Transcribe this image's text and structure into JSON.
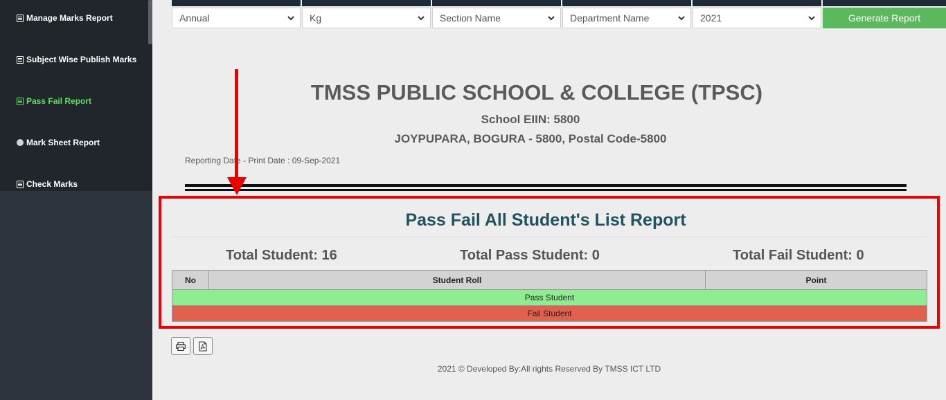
{
  "sidebar": {
    "items": [
      {
        "label": "Manage Marks Report",
        "icon": "document-icon"
      },
      {
        "label": "Subject Wise Publish Marks",
        "icon": "document-icon"
      },
      {
        "label": "Pass Fail Report",
        "icon": "document-icon",
        "active": true
      },
      {
        "label": "Mark Sheet Report",
        "icon": "circle-icon"
      },
      {
        "label": "Check Marks",
        "icon": "document-icon"
      }
    ]
  },
  "filters": {
    "exam": "Annual",
    "class": "Kg",
    "section": "Section Name",
    "department": "Department Name",
    "year": "2021",
    "generate_label": "Generate Report"
  },
  "header": {
    "school_name": "TMSS PUBLIC SCHOOL & COLLEGE (TPSC)",
    "eiin": "School EIIN: 5800",
    "address": "JOYPUPARA, BOGURA - 5800, Postal Code-5800",
    "reporting_date": "Reporting Date - Print Date : 09-Sep-2021"
  },
  "report": {
    "title": "Pass Fail All Student's List Report",
    "total_student": "Total Student: 16",
    "total_pass": "Total Pass Student: 0",
    "total_fail": "Total Fail Student: 0",
    "columns": [
      "No",
      "Student Roll",
      "Point"
    ],
    "pass_row_label": "Pass Student",
    "fail_row_label": "Fail Student"
  },
  "footer": "2021 © Developed By:All rights Reserved By TMSS ICT LTD",
  "colors": {
    "sidebar_bg": "#20262c",
    "active_menu": "#5ee05e",
    "generate_button": "#5cb85c",
    "pass_row": "#90ec90",
    "fail_row": "#e0614e",
    "annotation": "#ee0000"
  }
}
